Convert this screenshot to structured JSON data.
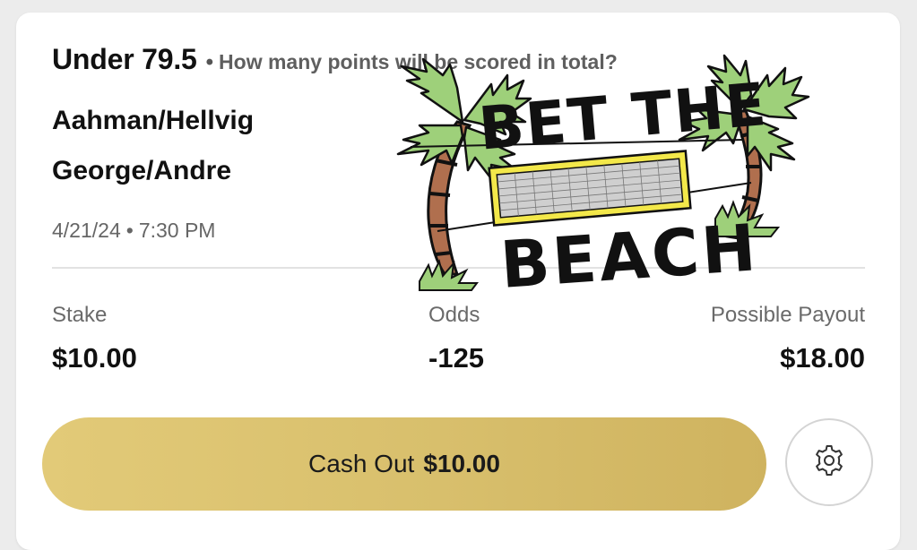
{
  "bet": {
    "selection": "Under 79.5",
    "separator": "•",
    "question": "How many points will be scored in total?",
    "team_1": "Aahman/Hellvig",
    "team_2": "George/Andre",
    "date": "4/21/24",
    "time": "7:30 PM"
  },
  "stats": {
    "stake_label": "Stake",
    "stake_value": "$10.00",
    "odds_label": "Odds",
    "odds_value": "-125",
    "payout_label": "Possible Payout",
    "payout_value": "$18.00"
  },
  "cashout": {
    "label": "Cash Out",
    "amount": "$10.00"
  },
  "logo": {
    "line_1": "BET THE",
    "line_2": "BEACH"
  },
  "icons": {
    "settings": "gear-icon",
    "logo": "palm-tree-icon"
  },
  "colors": {
    "cashout_gold": "#d8bf6c",
    "palm_green": "#9ed07a",
    "trunk_brown": "#b06f4e",
    "net_yellow": "#f3e84a"
  }
}
